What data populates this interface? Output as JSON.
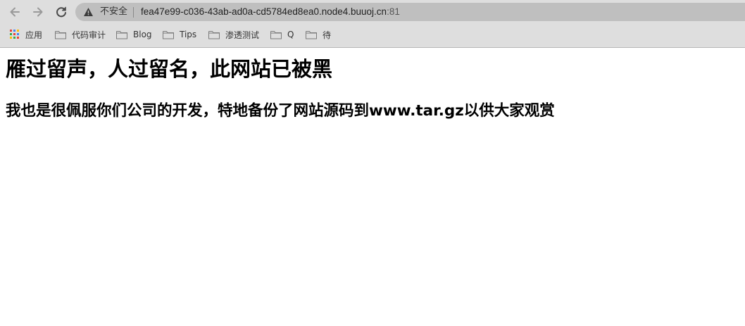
{
  "browser": {
    "nav": {
      "back_icon": "arrow-left-icon",
      "forward_icon": "arrow-right-icon",
      "reload_icon": "reload-icon"
    },
    "omnibox": {
      "security_label": "不安全",
      "url_host": "fea47e99-c036-43ab-ad0a-cd5784ed8ea0.node4.buuoj.cn",
      "url_port": ":81"
    },
    "bookmarks": [
      {
        "label": "应用",
        "icon": "apps-grid-icon"
      },
      {
        "label": "代码审计",
        "icon": "folder-icon"
      },
      {
        "label": "Blog",
        "icon": "folder-icon"
      },
      {
        "label": "Tips",
        "icon": "folder-icon"
      },
      {
        "label": "渗透测试",
        "icon": "folder-icon"
      },
      {
        "label": "Q",
        "icon": "folder-icon"
      },
      {
        "label": "待",
        "icon": "folder-icon"
      }
    ]
  },
  "page": {
    "heading": "雁过留声，人过留名，此网站已被黑",
    "subheading": "我也是很佩服你们公司的开发，特地备份了网站源码到www.tar.gz以供大家观赏"
  },
  "colors": {
    "toolbar_bg": "#dedede",
    "omnibox_bg": "#bfbfbf",
    "page_bg": "#ffffff",
    "text": "#000000"
  }
}
